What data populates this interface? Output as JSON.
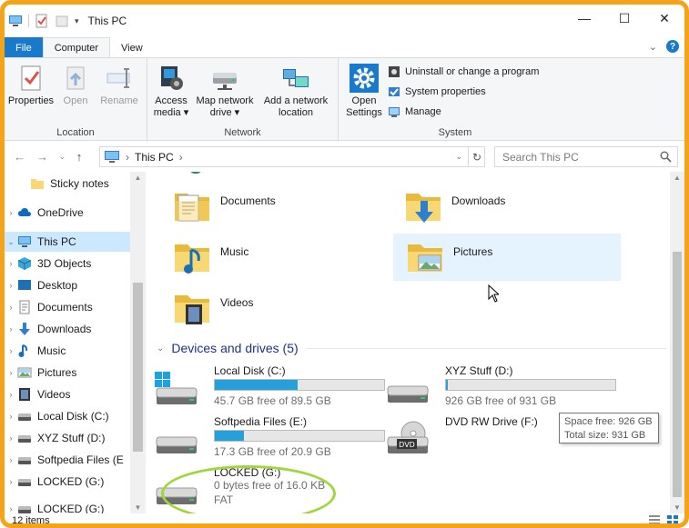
{
  "window": {
    "title": "This PC",
    "controls": {
      "minimize": "—",
      "maximize": "☐",
      "close": "✕"
    }
  },
  "ribbon_tabs": [
    {
      "label": "File"
    },
    {
      "label": "Computer"
    },
    {
      "label": "View"
    }
  ],
  "ribbon": {
    "location": {
      "label": "Location",
      "buttons": [
        {
          "label": "Properties",
          "icon": "properties-icon"
        },
        {
          "label": "Open",
          "icon": "open-icon",
          "disabled": true
        },
        {
          "label": "Rename",
          "icon": "rename-icon",
          "disabled": true
        }
      ]
    },
    "network": {
      "label": "Network",
      "buttons": [
        {
          "line1": "Access",
          "line2": "media ▾",
          "icon": "access-media-icon"
        },
        {
          "line1": "Map network",
          "line2": "drive ▾",
          "icon": "map-network-drive-icon"
        },
        {
          "line1": "Add a network",
          "line2": "location",
          "icon": "add-network-location-icon"
        }
      ]
    },
    "system": {
      "label": "System",
      "open_settings": {
        "line1": "Open",
        "line2": "Settings"
      },
      "small": [
        {
          "label": "Uninstall or change a program",
          "icon": "uninstall-icon"
        },
        {
          "label": "System properties",
          "icon": "system-properties-icon"
        },
        {
          "label": "Manage",
          "icon": "manage-icon"
        }
      ]
    }
  },
  "address": {
    "path": "This PC",
    "separator": "›",
    "search_placeholder": "Search This PC"
  },
  "sidebar": {
    "items": [
      {
        "label": "Sticky notes",
        "icon": "folder-icon",
        "level": 1
      },
      {
        "label": "OneDrive",
        "icon": "cloud-icon",
        "level": 0
      },
      {
        "label": "This PC",
        "icon": "computer-icon",
        "level": 0,
        "selected": true,
        "expanded": true
      },
      {
        "label": "3D Objects",
        "icon": "cube-icon",
        "level": 1
      },
      {
        "label": "Desktop",
        "icon": "desktop-icon",
        "level": 1
      },
      {
        "label": "Documents",
        "icon": "documents-icon",
        "level": 1
      },
      {
        "label": "Downloads",
        "icon": "downloads-icon",
        "level": 1
      },
      {
        "label": "Music",
        "icon": "music-icon",
        "level": 1
      },
      {
        "label": "Pictures",
        "icon": "pictures-icon",
        "level": 1
      },
      {
        "label": "Videos",
        "icon": "videos-icon",
        "level": 1
      },
      {
        "label": "Local Disk (C:)",
        "icon": "drive-icon",
        "level": 1
      },
      {
        "label": "XYZ Stuff (D:)",
        "icon": "drive-icon",
        "level": 1
      },
      {
        "label": "Softpedia Files (E",
        "icon": "drive-icon",
        "level": 1
      },
      {
        "label": "LOCKED (G:)",
        "icon": "drive-icon",
        "level": 1
      },
      {
        "label": "LOCKED (G:)",
        "icon": "drive-icon",
        "level": 1
      }
    ]
  },
  "folders": [
    {
      "label": "Documents",
      "icon": "documents-folder-icon"
    },
    {
      "label": "Downloads",
      "icon": "downloads-folder-icon"
    },
    {
      "label": "Music",
      "icon": "music-folder-icon"
    },
    {
      "label": "Pictures",
      "icon": "pictures-folder-icon",
      "hover": true
    },
    {
      "label": "Videos",
      "icon": "videos-folder-icon"
    }
  ],
  "devices_heading": "Devices and drives (5)",
  "drives": [
    {
      "name": "Local Disk (C:)",
      "free": "45.7 GB free of 89.5 GB",
      "used_fraction": 0.49,
      "icon": "windows-drive-icon"
    },
    {
      "name": "XYZ Stuff (D:)",
      "free": "926 GB free of 931 GB",
      "used_fraction": 0.01,
      "icon": "hard-drive-icon"
    },
    {
      "name": "Softpedia Files (E:)",
      "free": "17.3 GB free of 20.9 GB",
      "used_fraction": 0.17,
      "icon": "hard-drive-icon"
    },
    {
      "name": "DVD RW Drive (F:)",
      "icon": "dvd-drive-icon"
    },
    {
      "name": "LOCKED (G:)",
      "free": "0 bytes free of 16.0 KB",
      "fs": "FAT",
      "icon": "hard-drive-icon"
    }
  ],
  "tooltip": {
    "line1": "Space free: 926 GB",
    "line2": "Total size: 931 GB"
  },
  "status": {
    "items_count": "12 items"
  },
  "colors": {
    "accent": "#1979ca",
    "selection": "#cce8ff",
    "hover": "#e5f3ff",
    "progress": "#26a0da",
    "frame": "#f5a417",
    "highlight_circle": "#9fd63b"
  }
}
